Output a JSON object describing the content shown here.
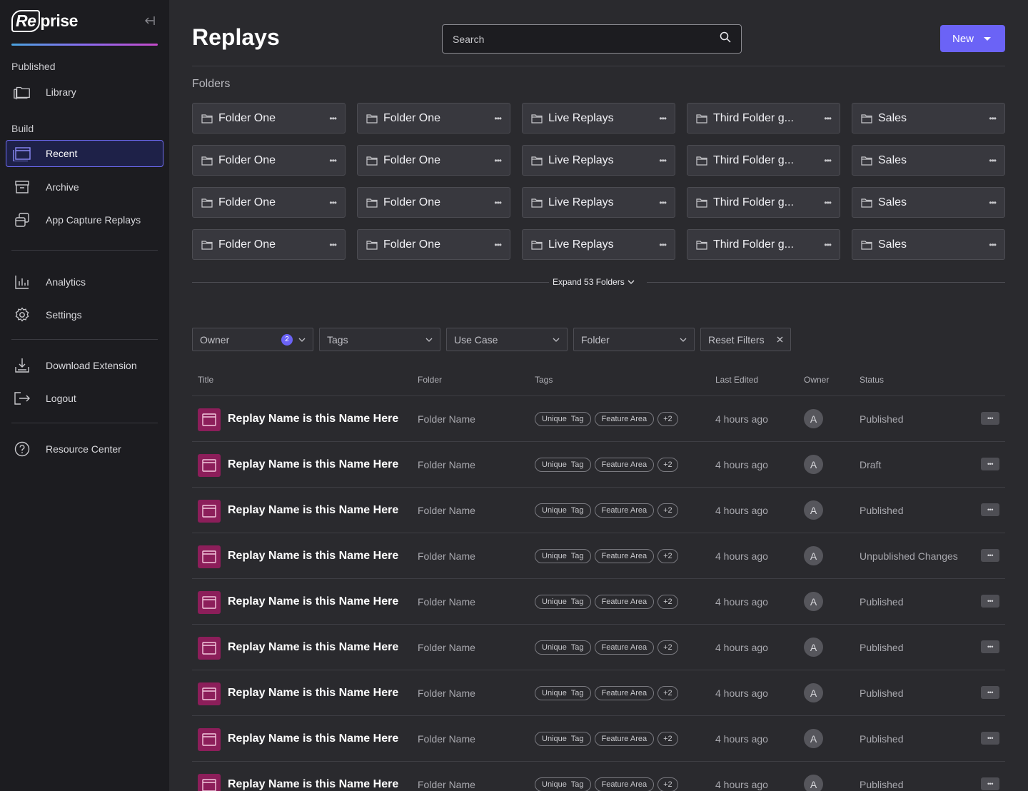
{
  "sidebar": {
    "logo": "Reprise",
    "logo_parts": [
      "Re",
      "prise"
    ],
    "sections": {
      "published": "Published",
      "build": "Build"
    },
    "items": [
      {
        "label": "Library",
        "icon": "folders-icon"
      },
      {
        "label": "Recent",
        "icon": "browser-window-icon",
        "active": true
      },
      {
        "label": "Archive",
        "icon": "archive-box-icon"
      },
      {
        "label": "App Capture Replays",
        "icon": "stacked-windows-icon"
      },
      {
        "label": "Analytics",
        "icon": "bar-chart-icon"
      },
      {
        "label": "Settings",
        "icon": "gear-icon"
      },
      {
        "label": "Download Extension",
        "icon": "download-icon"
      },
      {
        "label": "Logout",
        "icon": "logout-icon"
      },
      {
        "label": "Resource Center",
        "icon": "help-circle-icon"
      }
    ],
    "accent_gradient": [
      "#4aa3df",
      "#8b6cf2",
      "#c44ac9"
    ]
  },
  "header": {
    "title": "Replays",
    "search_placeholder": "Search",
    "new_button": "New",
    "accent": "#6b63f6"
  },
  "folders": {
    "label": "Folders",
    "rows": [
      [
        "Folder One",
        "Folder One",
        "Live Replays",
        "Third Folder g...",
        "Sales"
      ],
      [
        "Folder One",
        "Folder One",
        "Live Replays",
        "Third Folder g...",
        "Sales"
      ],
      [
        "Folder One",
        "Folder One",
        "Live Replays",
        "Third Folder g...",
        "Sales"
      ],
      [
        "Folder One",
        "Folder One",
        "Live Replays",
        "Third Folder g...",
        "Sales"
      ]
    ],
    "expand_label": "Expand 53 Folders"
  },
  "filters": {
    "owner": "Owner",
    "owner_count": "2",
    "tags": "Tags",
    "use_case": "Use Case",
    "folder": "Folder",
    "reset": "Reset Filters"
  },
  "table": {
    "columns": [
      "Title",
      "Folder",
      "Tags",
      "Last Edited",
      "Owner",
      "Status"
    ],
    "rows": [
      {
        "title": "Replay Name is this Name Here",
        "folder": "Folder Name",
        "tags": [
          "Unique  Tag",
          "Feature Area",
          "+2"
        ],
        "edited": "4 hours ago",
        "owner": "A",
        "status": "Published"
      },
      {
        "title": "Replay Name is this Name Here",
        "folder": "Folder Name",
        "tags": [
          "Unique  Tag",
          "Feature Area",
          "+2"
        ],
        "edited": "4 hours ago",
        "owner": "A",
        "status": "Draft"
      },
      {
        "title": "Replay Name is this Name Here",
        "folder": "Folder Name",
        "tags": [
          "Unique  Tag",
          "Feature Area",
          "+2"
        ],
        "edited": "4 hours ago",
        "owner": "A",
        "status": "Published"
      },
      {
        "title": "Replay Name is this Name Here",
        "folder": "Folder Name",
        "tags": [
          "Unique  Tag",
          "Feature Area",
          "+2"
        ],
        "edited": "4 hours ago",
        "owner": "A",
        "status": "Unpublished Changes"
      },
      {
        "title": "Replay Name is this Name Here",
        "folder": "Folder Name",
        "tags": [
          "Unique  Tag",
          "Feature Area",
          "+2"
        ],
        "edited": "4 hours ago",
        "owner": "A",
        "status": "Published"
      },
      {
        "title": "Replay Name is this Name Here",
        "folder": "Folder Name",
        "tags": [
          "Unique  Tag",
          "Feature Area",
          "+2"
        ],
        "edited": "4 hours ago",
        "owner": "A",
        "status": "Published"
      },
      {
        "title": "Replay Name is this Name Here",
        "folder": "Folder Name",
        "tags": [
          "Unique  Tag",
          "Feature Area",
          "+2"
        ],
        "edited": "4 hours ago",
        "owner": "A",
        "status": "Published"
      },
      {
        "title": "Replay Name is this Name Here",
        "folder": "Folder Name",
        "tags": [
          "Unique  Tag",
          "Feature Area",
          "+2"
        ],
        "edited": "4 hours ago",
        "owner": "A",
        "status": "Published"
      },
      {
        "title": "Replay Name is this Name Here",
        "folder": "Folder Name",
        "tags": [
          "Unique  Tag",
          "Feature Area",
          "+2"
        ],
        "edited": "4 hours ago",
        "owner": "A",
        "status": "Published"
      }
    ],
    "row_icon_color": "#8c1e5a"
  }
}
